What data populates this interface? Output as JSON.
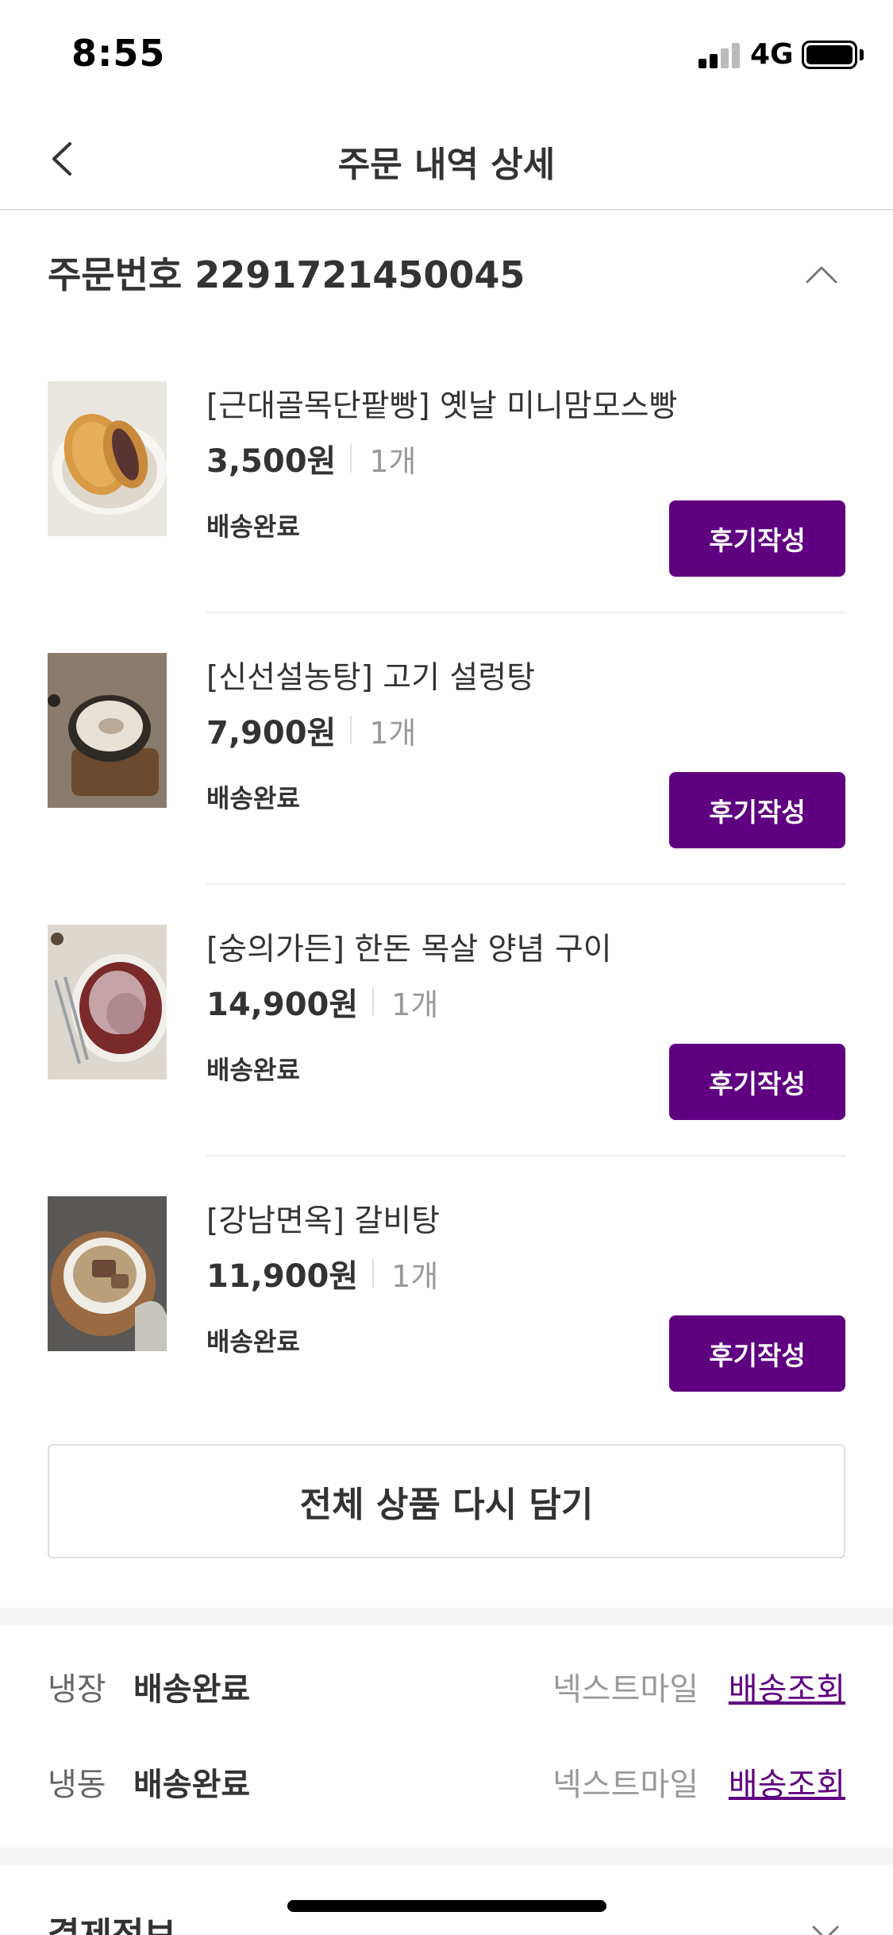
{
  "status_bar": {
    "time": "8:55",
    "network": "4G"
  },
  "nav": {
    "title": "주문 내역 상세",
    "back_icon": "chevron-left-icon"
  },
  "order": {
    "label": "주문번호 2291721450045",
    "collapse_icon": "chevron-up-icon"
  },
  "items": [
    {
      "name": "[근대골목단팥빵] 옛날 미니맘모스빵",
      "price": "3,500원",
      "qty": "1개",
      "status": "배송완료",
      "review_label": "후기작성"
    },
    {
      "name": "[신선설농탕] 고기 설렁탕",
      "price": "7,900원",
      "qty": "1개",
      "status": "배송완료",
      "review_label": "후기작성"
    },
    {
      "name": "[숭의가든] 한돈 목살 양념 구이",
      "price": "14,900원",
      "qty": "1개",
      "status": "배송완료",
      "review_label": "후기작성"
    },
    {
      "name": "[강남면옥] 갈비탕",
      "price": "11,900원",
      "qty": "1개",
      "status": "배송완료",
      "review_label": "후기작성"
    }
  ],
  "readd_all_label": "전체 상품 다시 담기",
  "shipments": [
    {
      "type": "냉장",
      "status": "배송완료",
      "courier": "넥스트마일",
      "track_label": "배송조회"
    },
    {
      "type": "냉동",
      "status": "배송완료",
      "courier": "넥스트마일",
      "track_label": "배송조회"
    }
  ],
  "payment": {
    "title": "결제정보",
    "toggle_icon": "chevron-down-icon"
  },
  "colors": {
    "brand": "#5f0080",
    "divider": "#dddddd",
    "text": "#333333",
    "muted": "#999999"
  }
}
